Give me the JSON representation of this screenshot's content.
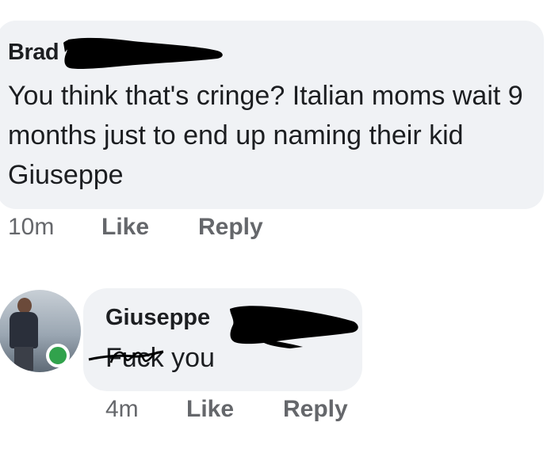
{
  "comment_1": {
    "author": "Brad",
    "text": "You think that's cringe? Italian moms wait 9 months just to end up naming their kid Giuseppe",
    "time": "10m",
    "like_label": "Like",
    "reply_label": "Reply"
  },
  "comment_2": {
    "author": "Giuseppe",
    "text_scribbled": "Fuck",
    "text": "you",
    "time": "4m",
    "like_label": "Like",
    "reply_label": "Reply",
    "online_status_color": "#31a24c"
  },
  "colors": {
    "bubble": "#f0f2f5",
    "text": "#1c1e21",
    "meta": "#65676b"
  }
}
